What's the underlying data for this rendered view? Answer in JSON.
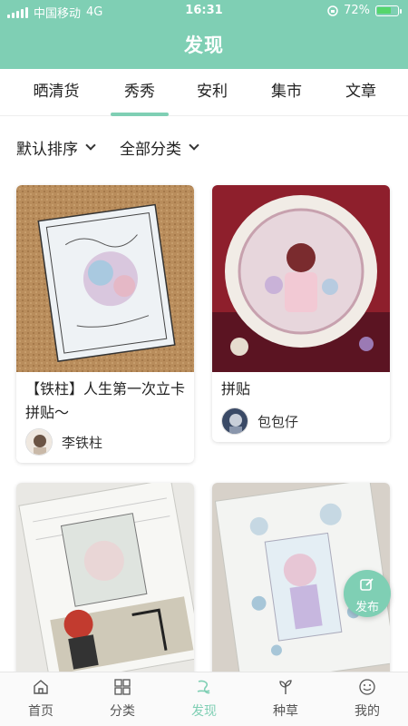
{
  "status_bar": {
    "carrier": "中国移动",
    "network": "4G",
    "time": "16:31",
    "battery": "72%",
    "battery_level": 0.72
  },
  "header": {
    "title": "发现"
  },
  "tabs": [
    {
      "label": "晒清货",
      "active": false
    },
    {
      "label": "秀秀",
      "active": true
    },
    {
      "label": "安利",
      "active": false
    },
    {
      "label": "集市",
      "active": false
    },
    {
      "label": "文章",
      "active": false
    }
  ],
  "filters": {
    "sort_label": "默认排序",
    "category_label": "全部分类"
  },
  "posts": [
    {
      "title": "【铁柱】人生第一次立卡拼贴～",
      "author": "李铁柱",
      "image": "vintage card collage on cork board"
    },
    {
      "title": "拼贴",
      "author": "包包仔",
      "image": "round lace frame collage on red"
    },
    {
      "image": "journal page collage with red-haired character"
    },
    {
      "image": "journal page collage with pastel character"
    }
  ],
  "fab": {
    "label": "发布",
    "icon": "edit-icon"
  },
  "bottom_nav": [
    {
      "label": "首页",
      "icon": "home-icon",
      "active": false
    },
    {
      "label": "分类",
      "icon": "grid-icon",
      "active": false
    },
    {
      "label": "发现",
      "icon": "discover-icon",
      "active": true
    },
    {
      "label": "种草",
      "icon": "sprout-icon",
      "active": false
    },
    {
      "label": "我的",
      "icon": "smile-icon",
      "active": false
    }
  ],
  "colors": {
    "accent": "#7fcfb4",
    "text": "#222222",
    "battery_green": "#55d66b"
  }
}
